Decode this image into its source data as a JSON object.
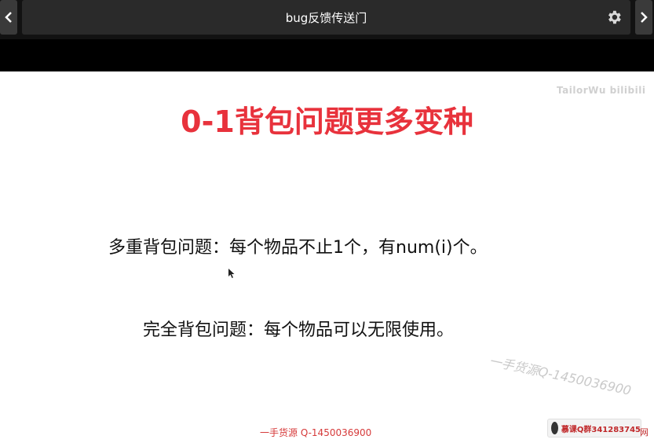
{
  "header": {
    "title": "bug反馈传送门",
    "icons": {
      "prev": "chevron-left-icon",
      "next": "chevron-right-icon",
      "settings": "gear-icon"
    }
  },
  "slide": {
    "title": "0-1背包问题更多变种",
    "line1": "多重背包问题：每个物品不止1个，有num(i)个。",
    "line2": "完全背包问题：每个物品可以无限使用。",
    "title_color": "#e8323c"
  },
  "watermarks": {
    "top_right": "TailorWu bilibili",
    "diagonal": "一手货源Q-1450036900",
    "bottom_center": "一手货源 Q-1450036900",
    "badge_text": "慕课Q群341283745",
    "badge_suffix": "网"
  }
}
